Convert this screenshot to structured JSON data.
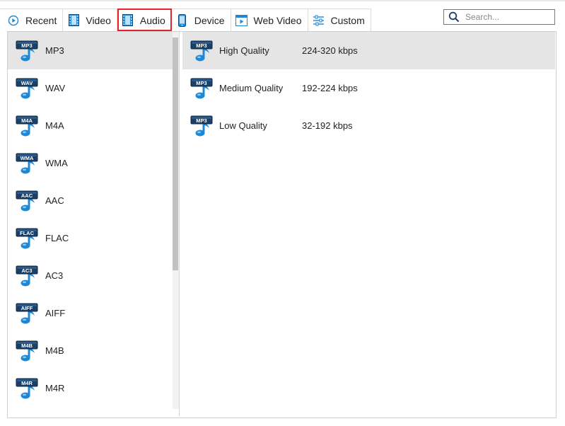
{
  "tabs": [
    {
      "label": "Recent",
      "icon": "recent-icon"
    },
    {
      "label": "Video",
      "icon": "film-icon"
    },
    {
      "label": "Audio",
      "icon": "film-icon"
    },
    {
      "label": "Device",
      "icon": "phone-icon"
    },
    {
      "label": "Web Video",
      "icon": "web-video-icon"
    },
    {
      "label": "Custom",
      "icon": "sliders-icon"
    }
  ],
  "active_tab": "Audio",
  "search": {
    "placeholder": "Search...",
    "value": ""
  },
  "formats": [
    {
      "label": "MP3",
      "badge": "MP3"
    },
    {
      "label": "WAV",
      "badge": "WAV"
    },
    {
      "label": "M4A",
      "badge": "M4A"
    },
    {
      "label": "WMA",
      "badge": "WMA"
    },
    {
      "label": "AAC",
      "badge": "AAC"
    },
    {
      "label": "FLAC",
      "badge": "FLAC"
    },
    {
      "label": "AC3",
      "badge": "AC3"
    },
    {
      "label": "AIFF",
      "badge": "AIFF"
    },
    {
      "label": "M4B",
      "badge": "M4B"
    },
    {
      "label": "M4R",
      "badge": "M4R"
    }
  ],
  "selected_format": "MP3",
  "qualities": [
    {
      "name": "High Quality",
      "rate": "224-320 kbps",
      "badge": "MP3"
    },
    {
      "name": "Medium Quality",
      "rate": "192-224 kbps",
      "badge": "MP3"
    },
    {
      "name": "Low Quality",
      "rate": "32-192 kbps",
      "badge": "MP3"
    }
  ],
  "selected_quality": "High Quality",
  "colors": {
    "accent_red": "#e0252c",
    "icon_blue": "#1e88d8",
    "badge_dark": "#1b3f66",
    "selected_bg": "#e5e5e5"
  }
}
